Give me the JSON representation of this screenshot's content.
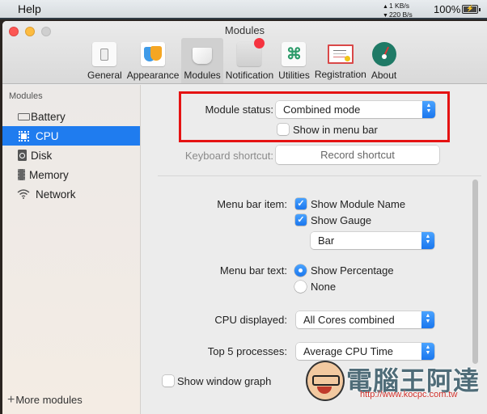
{
  "menubar": {
    "menu_item": "Help",
    "network": {
      "upload": "1 KB/s",
      "download": "220 B/s"
    },
    "battery_percent": "100%"
  },
  "window": {
    "title": "Modules",
    "toolbar": [
      {
        "label": "General",
        "icon": "toggle-switch-icon",
        "active": false
      },
      {
        "label": "Appearance",
        "icon": "theater-masks-icon",
        "active": false
      },
      {
        "label": "Modules",
        "icon": "module-box-icon",
        "active": true
      },
      {
        "label": "Notification",
        "icon": "notification-badge-icon",
        "active": false
      },
      {
        "label": "Utilities",
        "icon": "command-key-icon",
        "active": false
      },
      {
        "label": "Registration",
        "icon": "license-certificate-icon",
        "active": false
      },
      {
        "label": "About",
        "icon": "gauge-icon",
        "active": false
      }
    ]
  },
  "sidebar": {
    "header": "Modules",
    "items": [
      {
        "label": "Battery",
        "icon": "battery-icon",
        "selected": false
      },
      {
        "label": "CPU",
        "icon": "cpu-chip-icon",
        "selected": true
      },
      {
        "label": "Disk",
        "icon": "disk-drive-icon",
        "selected": false
      },
      {
        "label": "Memory",
        "icon": "memory-chip-icon",
        "selected": false
      },
      {
        "label": "Network",
        "icon": "wifi-icon",
        "selected": false
      }
    ],
    "more_modules": "More modules"
  },
  "main": {
    "module_status": {
      "label": "Module status:",
      "value": "Combined mode"
    },
    "show_in_menu_bar": {
      "label": "Show in menu bar",
      "checked": false
    },
    "keyboard_shortcut": {
      "label": "Keyboard shortcut:",
      "button": "Record shortcut"
    },
    "menu_bar_item": {
      "label": "Menu bar item:",
      "show_module_name": {
        "label": "Show Module Name",
        "checked": true
      },
      "show_gauge": {
        "label": "Show Gauge",
        "checked": true
      },
      "gauge_type": "Bar"
    },
    "menu_bar_text": {
      "label": "Menu bar text:",
      "options": [
        {
          "label": "Show Percentage",
          "selected": true
        },
        {
          "label": "None",
          "selected": false
        }
      ]
    },
    "cpu_displayed": {
      "label": "CPU displayed:",
      "value": "All Cores combined"
    },
    "top_processes": {
      "label": "Top 5 processes:",
      "value": "Average CPU Time"
    },
    "show_window_graph": {
      "label": "Show window graph",
      "checked": false
    }
  },
  "watermark": {
    "title": "電腦王阿達",
    "url": "http://www.kocpc.com.tw"
  },
  "colors": {
    "accent": "#1f7cef",
    "highlight_box": "#e51313"
  }
}
